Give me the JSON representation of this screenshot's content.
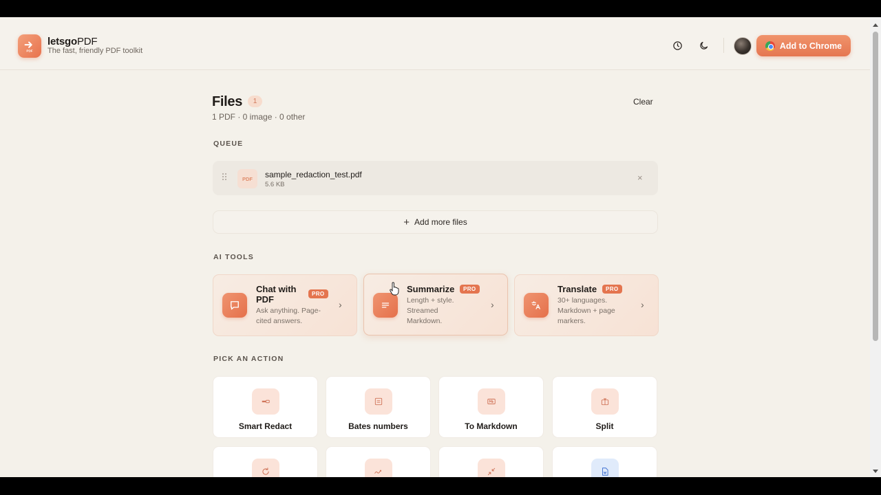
{
  "app": {
    "brand_bold": "letsgo",
    "brand_rest": "PDF",
    "tagline": "The fast, friendly PDF toolkit",
    "logo_text": "PDF",
    "add_to_chrome": "Add to Chrome",
    "icons": [
      "history-icon",
      "moon-icon",
      "chrome-icon"
    ]
  },
  "files": {
    "title": "Files",
    "count": "1",
    "summary": "1 PDF · 0 image · 0 other",
    "clear_label": "Clear"
  },
  "queue": {
    "label": "QUEUE",
    "items": [
      {
        "thumb": "PDF",
        "name": "sample_redaction_test.pdf",
        "size": "5.6 KB",
        "remove": "×"
      }
    ],
    "add_more": "Add more files"
  },
  "ai_tools": {
    "label": "AI TOOLS",
    "badge": "PRO",
    "cards": [
      {
        "title_line1": "Chat with",
        "title_line2": "PDF",
        "desc_line1": "Ask anything. Page-",
        "desc_line2": "cited answers.",
        "icon": "chat-bubble-icon"
      },
      {
        "title": "Summarize",
        "desc_line1": "Length + style.",
        "desc_line2": "Streamed",
        "desc_line3": "Markdown.",
        "icon": "summary-lines-icon"
      },
      {
        "title": "Translate",
        "desc_line1": "30+ languages.",
        "desc_line2": "Markdown + page",
        "desc_line3": "markers.",
        "icon": "translate-icon"
      }
    ]
  },
  "actions": {
    "label": "PICK AN ACTION",
    "items": [
      {
        "label": "Smart Redact",
        "icon": "redact-icon"
      },
      {
        "label": "Bates numbers",
        "icon": "bates-icon"
      },
      {
        "label": "To Markdown",
        "icon": "markdown-icon"
      },
      {
        "label": "Split",
        "icon": "split-icon"
      }
    ],
    "row2_icons": [
      "rotate-icon",
      "sign-icon",
      "compress-icon",
      "word-icon"
    ]
  },
  "colors": {
    "accent": "#e5704b",
    "accent_light": "#fbe3d9",
    "background": "#f4f1ea"
  }
}
